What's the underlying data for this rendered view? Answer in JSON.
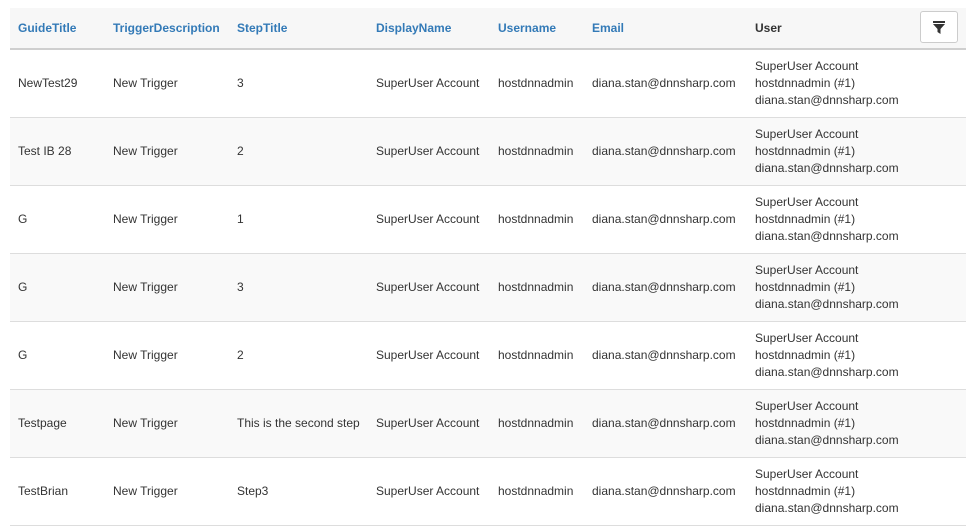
{
  "table": {
    "columns": [
      "GuideTitle",
      "TriggerDescription",
      "StepTitle",
      "DisplayName",
      "Username",
      "Email",
      "User"
    ],
    "filter_icon": "filter-icon",
    "rows": [
      {
        "guide": "NewTest29",
        "trigger": "New Trigger",
        "step": "3",
        "display": "SuperUser Account",
        "username": "hostdnnadmin",
        "email": "diana.stan@dnnsharp.com",
        "user": [
          "SuperUser Account",
          "hostdnnadmin (#1)",
          "diana.stan@dnnsharp.com"
        ]
      },
      {
        "guide": "Test IB 28",
        "trigger": "New Trigger",
        "step": "2",
        "display": "SuperUser Account",
        "username": "hostdnnadmin",
        "email": "diana.stan@dnnsharp.com",
        "user": [
          "SuperUser Account",
          "hostdnnadmin (#1)",
          "diana.stan@dnnsharp.com"
        ]
      },
      {
        "guide": "G",
        "trigger": "New Trigger",
        "step": "1",
        "display": "SuperUser Account",
        "username": "hostdnnadmin",
        "email": "diana.stan@dnnsharp.com",
        "user": [
          "SuperUser Account",
          "hostdnnadmin (#1)",
          "diana.stan@dnnsharp.com"
        ]
      },
      {
        "guide": "G",
        "trigger": "New Trigger",
        "step": "3",
        "display": "SuperUser Account",
        "username": "hostdnnadmin",
        "email": "diana.stan@dnnsharp.com",
        "user": [
          "SuperUser Account",
          "hostdnnadmin (#1)",
          "diana.stan@dnnsharp.com"
        ]
      },
      {
        "guide": "G",
        "trigger": "New Trigger",
        "step": "2",
        "display": "SuperUser Account",
        "username": "hostdnnadmin",
        "email": "diana.stan@dnnsharp.com",
        "user": [
          "SuperUser Account",
          "hostdnnadmin (#1)",
          "diana.stan@dnnsharp.com"
        ]
      },
      {
        "guide": "Testpage",
        "trigger": "New Trigger",
        "step": "This is the second step",
        "display": "SuperUser Account",
        "username": "hostdnnadmin",
        "email": "diana.stan@dnnsharp.com",
        "user": [
          "SuperUser Account",
          "hostdnnadmin (#1)",
          "diana.stan@dnnsharp.com"
        ]
      },
      {
        "guide": "TestBrian",
        "trigger": "New Trigger",
        "step": "Step3",
        "display": "SuperUser Account",
        "username": "hostdnnadmin",
        "email": "diana.stan@dnnsharp.com",
        "user": [
          "SuperUser Account",
          "hostdnnadmin (#1)",
          "diana.stan@dnnsharp.com"
        ]
      }
    ]
  },
  "colors": {
    "header_link": "#337ab7",
    "text": "#333333",
    "row_border": "#dddddd"
  }
}
